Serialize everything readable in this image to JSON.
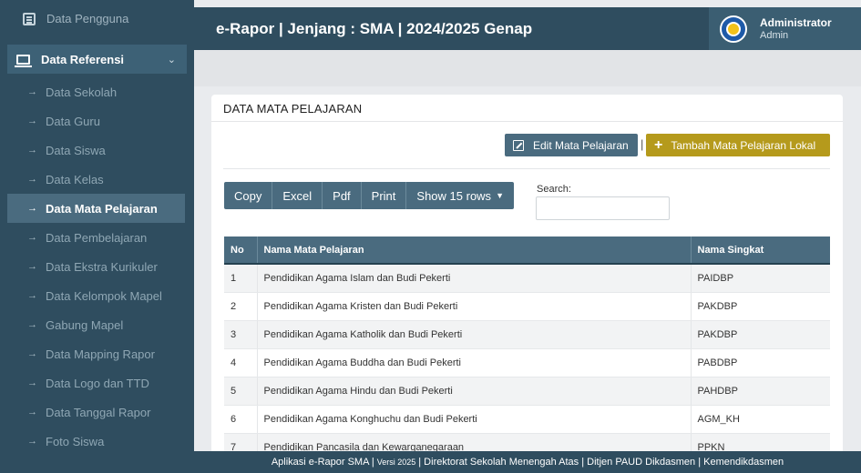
{
  "sidebar": {
    "top_item": "Data Pengguna",
    "group": {
      "label": "Data Referensi",
      "icon": "monitor-icon"
    },
    "items": [
      {
        "label": "Data Sekolah",
        "active": false
      },
      {
        "label": "Data Guru",
        "active": false
      },
      {
        "label": "Data Siswa",
        "active": false
      },
      {
        "label": "Data Kelas",
        "active": false
      },
      {
        "label": "Data Mata Pelajaran",
        "active": true
      },
      {
        "label": "Data Pembelajaran",
        "active": false
      },
      {
        "label": "Data Ekstra Kurikuler",
        "active": false
      },
      {
        "label": "Data Kelompok Mapel",
        "active": false
      },
      {
        "label": "Gabung Mapel",
        "active": false
      },
      {
        "label": "Data Mapping Rapor",
        "active": false
      },
      {
        "label": "Data Logo dan TTD",
        "active": false
      },
      {
        "label": "Data Tanggal Rapor",
        "active": false
      },
      {
        "label": "Foto Siswa",
        "active": false
      }
    ]
  },
  "header": {
    "title": "e-Rapor | Jenjang : SMA | 2024/2025 Genap",
    "user_name": "Administrator",
    "user_role": "Admin"
  },
  "card": {
    "title": "DATA MATA PELAJARAN",
    "edit_button": "Edit Mata Pelajaran",
    "separator": "|",
    "add_button": "Tambah Mata Pelajaran Lokal",
    "table_buttons": [
      "Copy",
      "Excel",
      "Pdf",
      "Print",
      "Show 15 rows"
    ],
    "search_label": "Search:",
    "search_value": ""
  },
  "table": {
    "columns": [
      "No",
      "Nama Mata Pelajaran",
      "Nama Singkat"
    ],
    "rows": [
      [
        "1",
        "Pendidikan Agama Islam dan Budi Pekerti",
        "PAIDBP"
      ],
      [
        "2",
        "Pendidikan Agama Kristen dan Budi Pekerti",
        "PAKDBP"
      ],
      [
        "3",
        "Pendidikan Agama Katholik dan Budi Pekerti",
        "PAKDBP"
      ],
      [
        "4",
        "Pendidikan Agama Buddha dan Budi Pekerti",
        "PABDBP"
      ],
      [
        "5",
        "Pendidikan Agama Hindu dan Budi Pekerti",
        "PAHDBP"
      ],
      [
        "6",
        "Pendidikan Agama Konghuchu dan Budi Pekerti",
        "AGM_KH"
      ],
      [
        "7",
        "Pendidikan Pancasila dan Kewarganegaraan",
        "PPKN"
      ]
    ]
  },
  "footer": {
    "text_before": "Aplikasi e-Rapor SMA |",
    "version": "Versi 2025",
    "text_after": "| Direktorat Sekolah Menengah Atas | Ditjen PAUD Dikdasmen | Kemendikdasmen"
  },
  "colors": {
    "sidebar_bg": "#2f4d5f",
    "accent": "#4a6b7f",
    "add_button": "#b59a1c"
  }
}
